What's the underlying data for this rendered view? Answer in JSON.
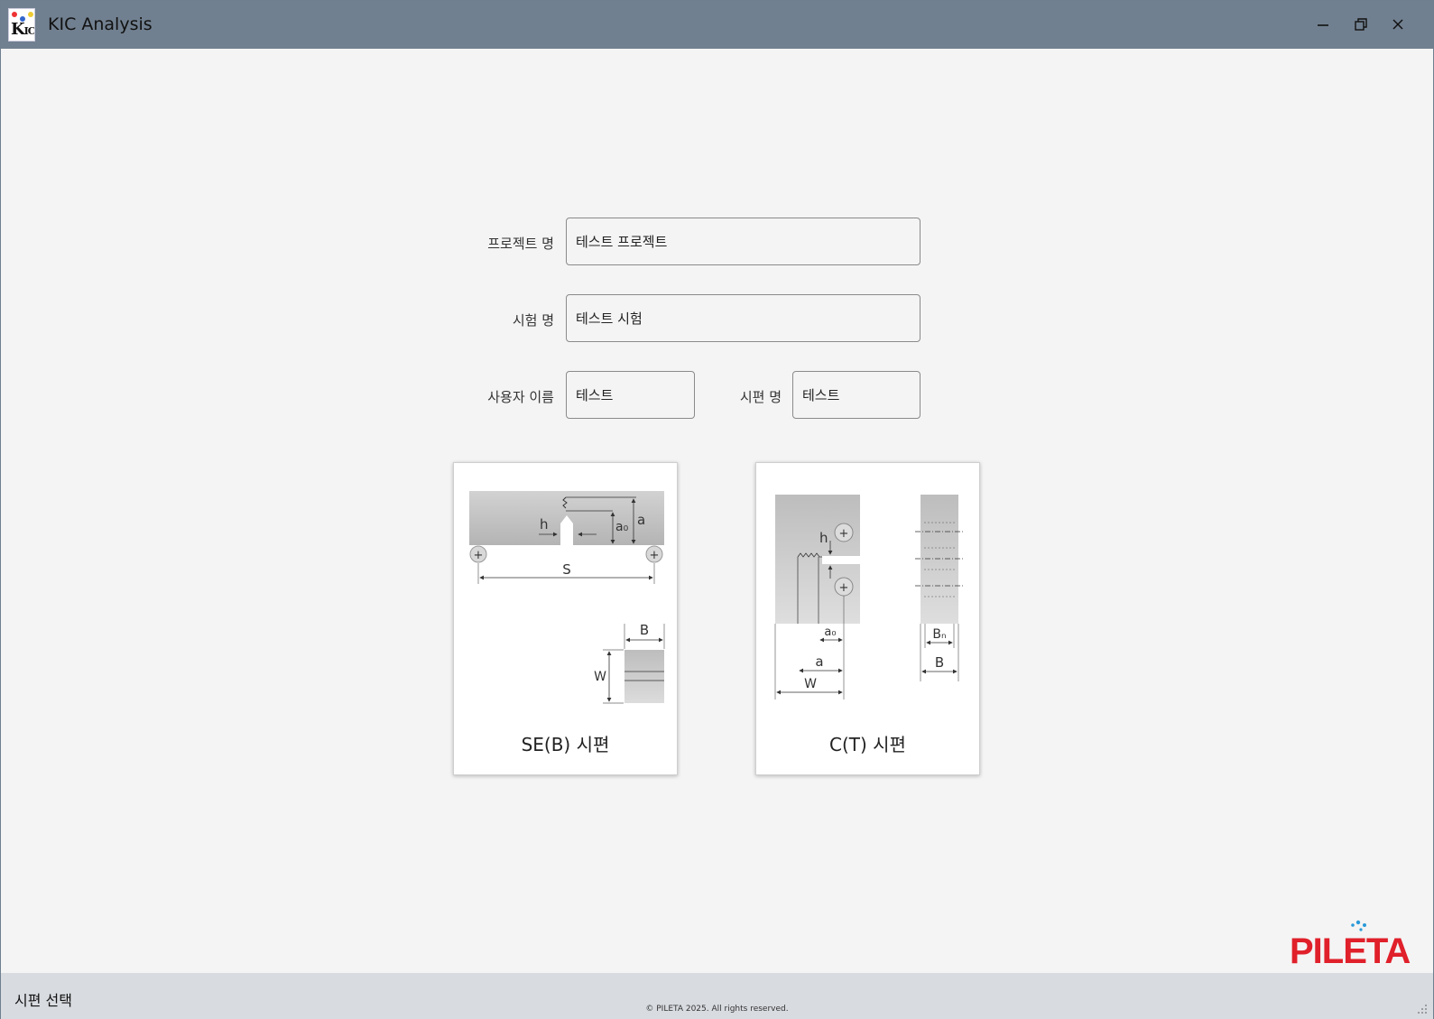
{
  "window": {
    "title": "KIC Analysis",
    "icon_text": "K",
    "icon_sub": "IC",
    "minimize_icon": "minimize-icon",
    "maximize_icon": "restore-icon",
    "close_icon": "close-icon"
  },
  "form": {
    "project_label": "프로젝트 명",
    "project_value": "테스트 프로젝트",
    "test_label": "시험 명",
    "test_value": "테스트 시험",
    "user_label": "사용자 이름",
    "user_value": "테스트",
    "specimen_label": "시편 명",
    "specimen_value": "테스트"
  },
  "specimens": {
    "seb": {
      "caption": "SE(B) 시편",
      "labels": {
        "h": "h",
        "a0": "a₀",
        "a": "a",
        "S": "S",
        "B": "B",
        "W": "W"
      }
    },
    "ct": {
      "caption": "C(T) 시편",
      "labels": {
        "h": "h",
        "a0": "a₀",
        "a": "a",
        "W": "W",
        "Bn": "Bₙ",
        "B": "B"
      }
    }
  },
  "status": {
    "text": "시편 선택",
    "copyright": "© PILETA 2025. All rights reserved."
  },
  "logo": {
    "text": "PILETA",
    "red": "#e0202a",
    "blue": "#2a9ad8"
  },
  "colors": {
    "titlebar": "#718090",
    "background": "#f4f4f4",
    "statusbar": "#d8dbe0"
  }
}
